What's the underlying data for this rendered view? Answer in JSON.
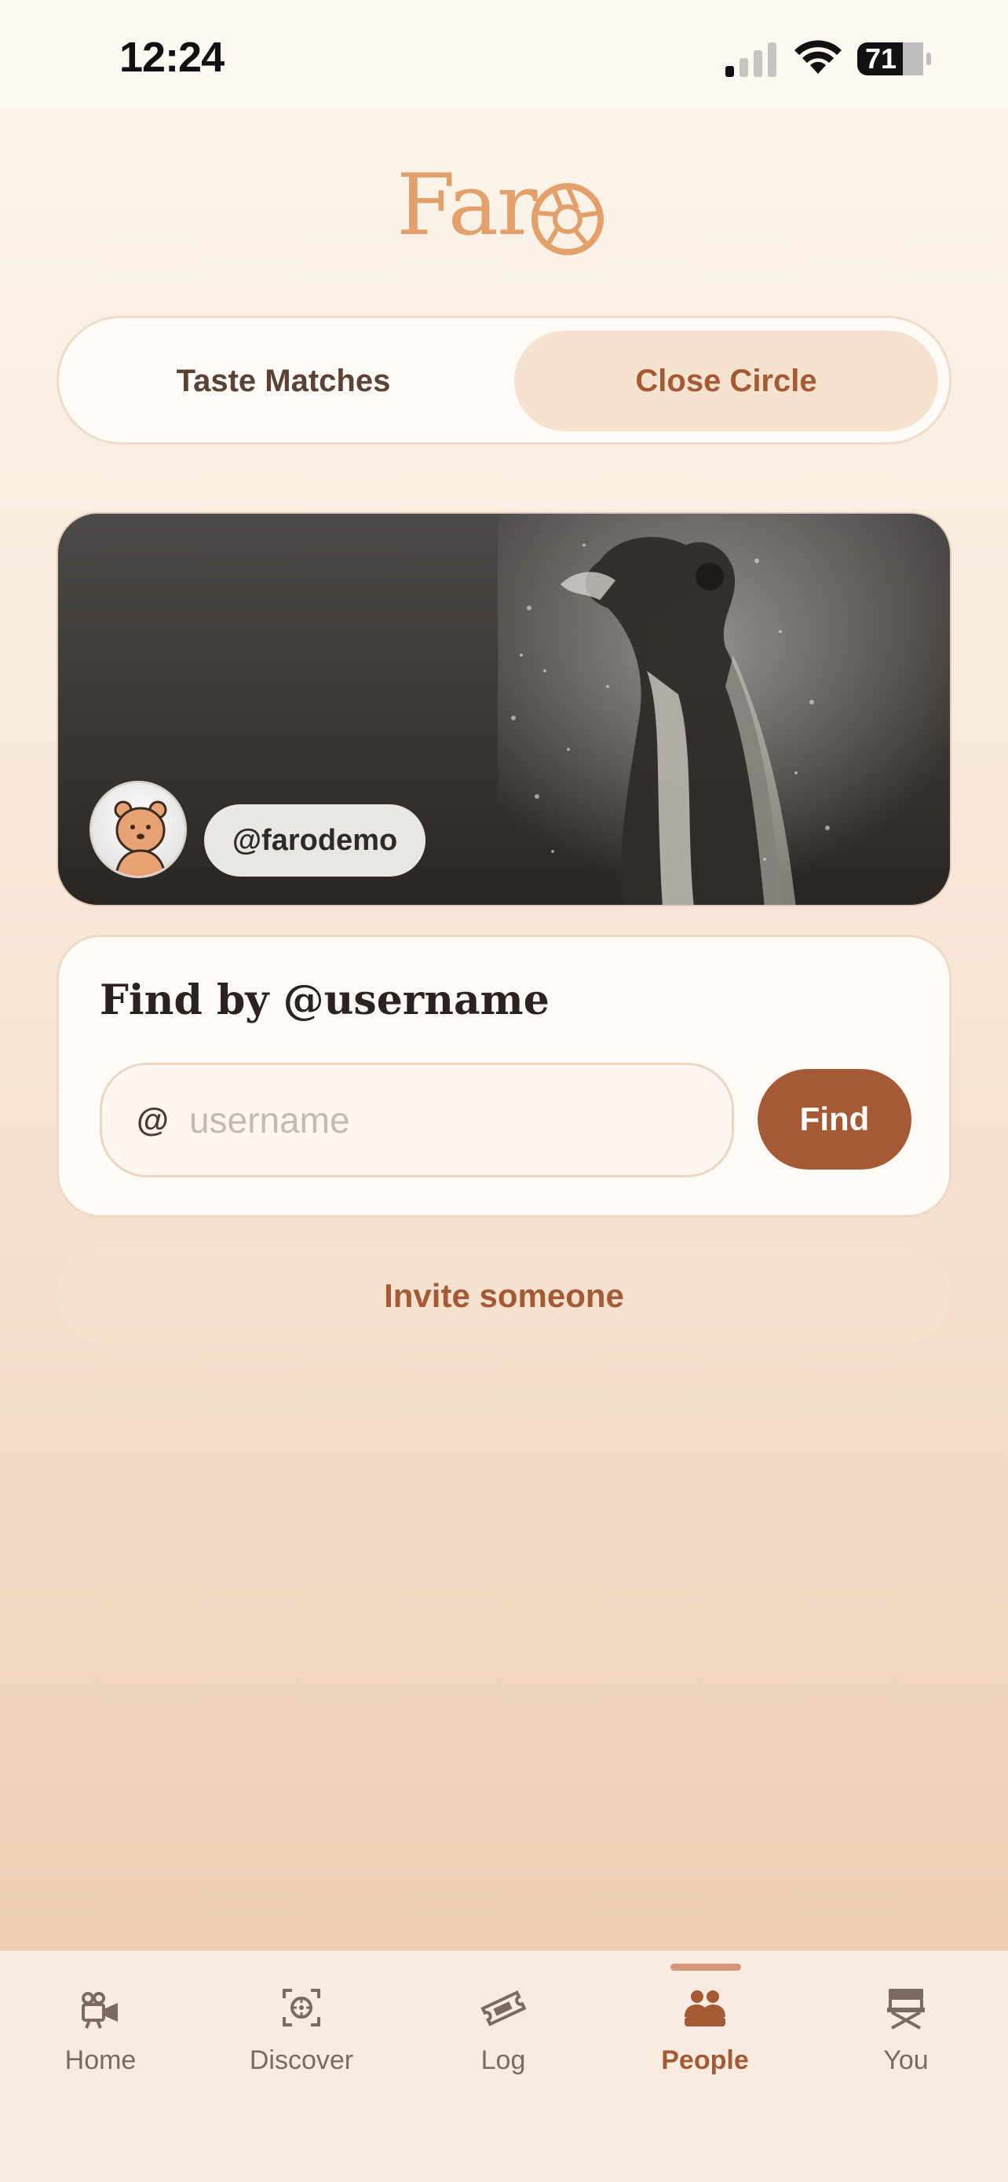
{
  "status_bar": {
    "time": "12:24",
    "battery": "71"
  },
  "app": {
    "logo_text": "Far",
    "brand_color": "#e4a06c",
    "accent_color": "#a55a35"
  },
  "segmented_control": {
    "left_label": "Taste Matches",
    "right_label": "Close Circle",
    "selected": "Close Circle"
  },
  "profile_banner": {
    "handle": "@farodemo"
  },
  "find_card": {
    "title": "Find by @username",
    "at_prefix": "@",
    "input_placeholder": "username",
    "input_value": "",
    "find_button": "Find"
  },
  "invite_button": "Invite someone",
  "tab_bar": {
    "active": "People",
    "items": [
      {
        "label": "Home",
        "icon": "camera-megaphone-icon"
      },
      {
        "label": "Discover",
        "icon": "focus-reel-icon"
      },
      {
        "label": "Log",
        "icon": "ticket-icon"
      },
      {
        "label": "People",
        "icon": "people-icon"
      },
      {
        "label": "You",
        "icon": "director-chair-icon"
      }
    ]
  }
}
